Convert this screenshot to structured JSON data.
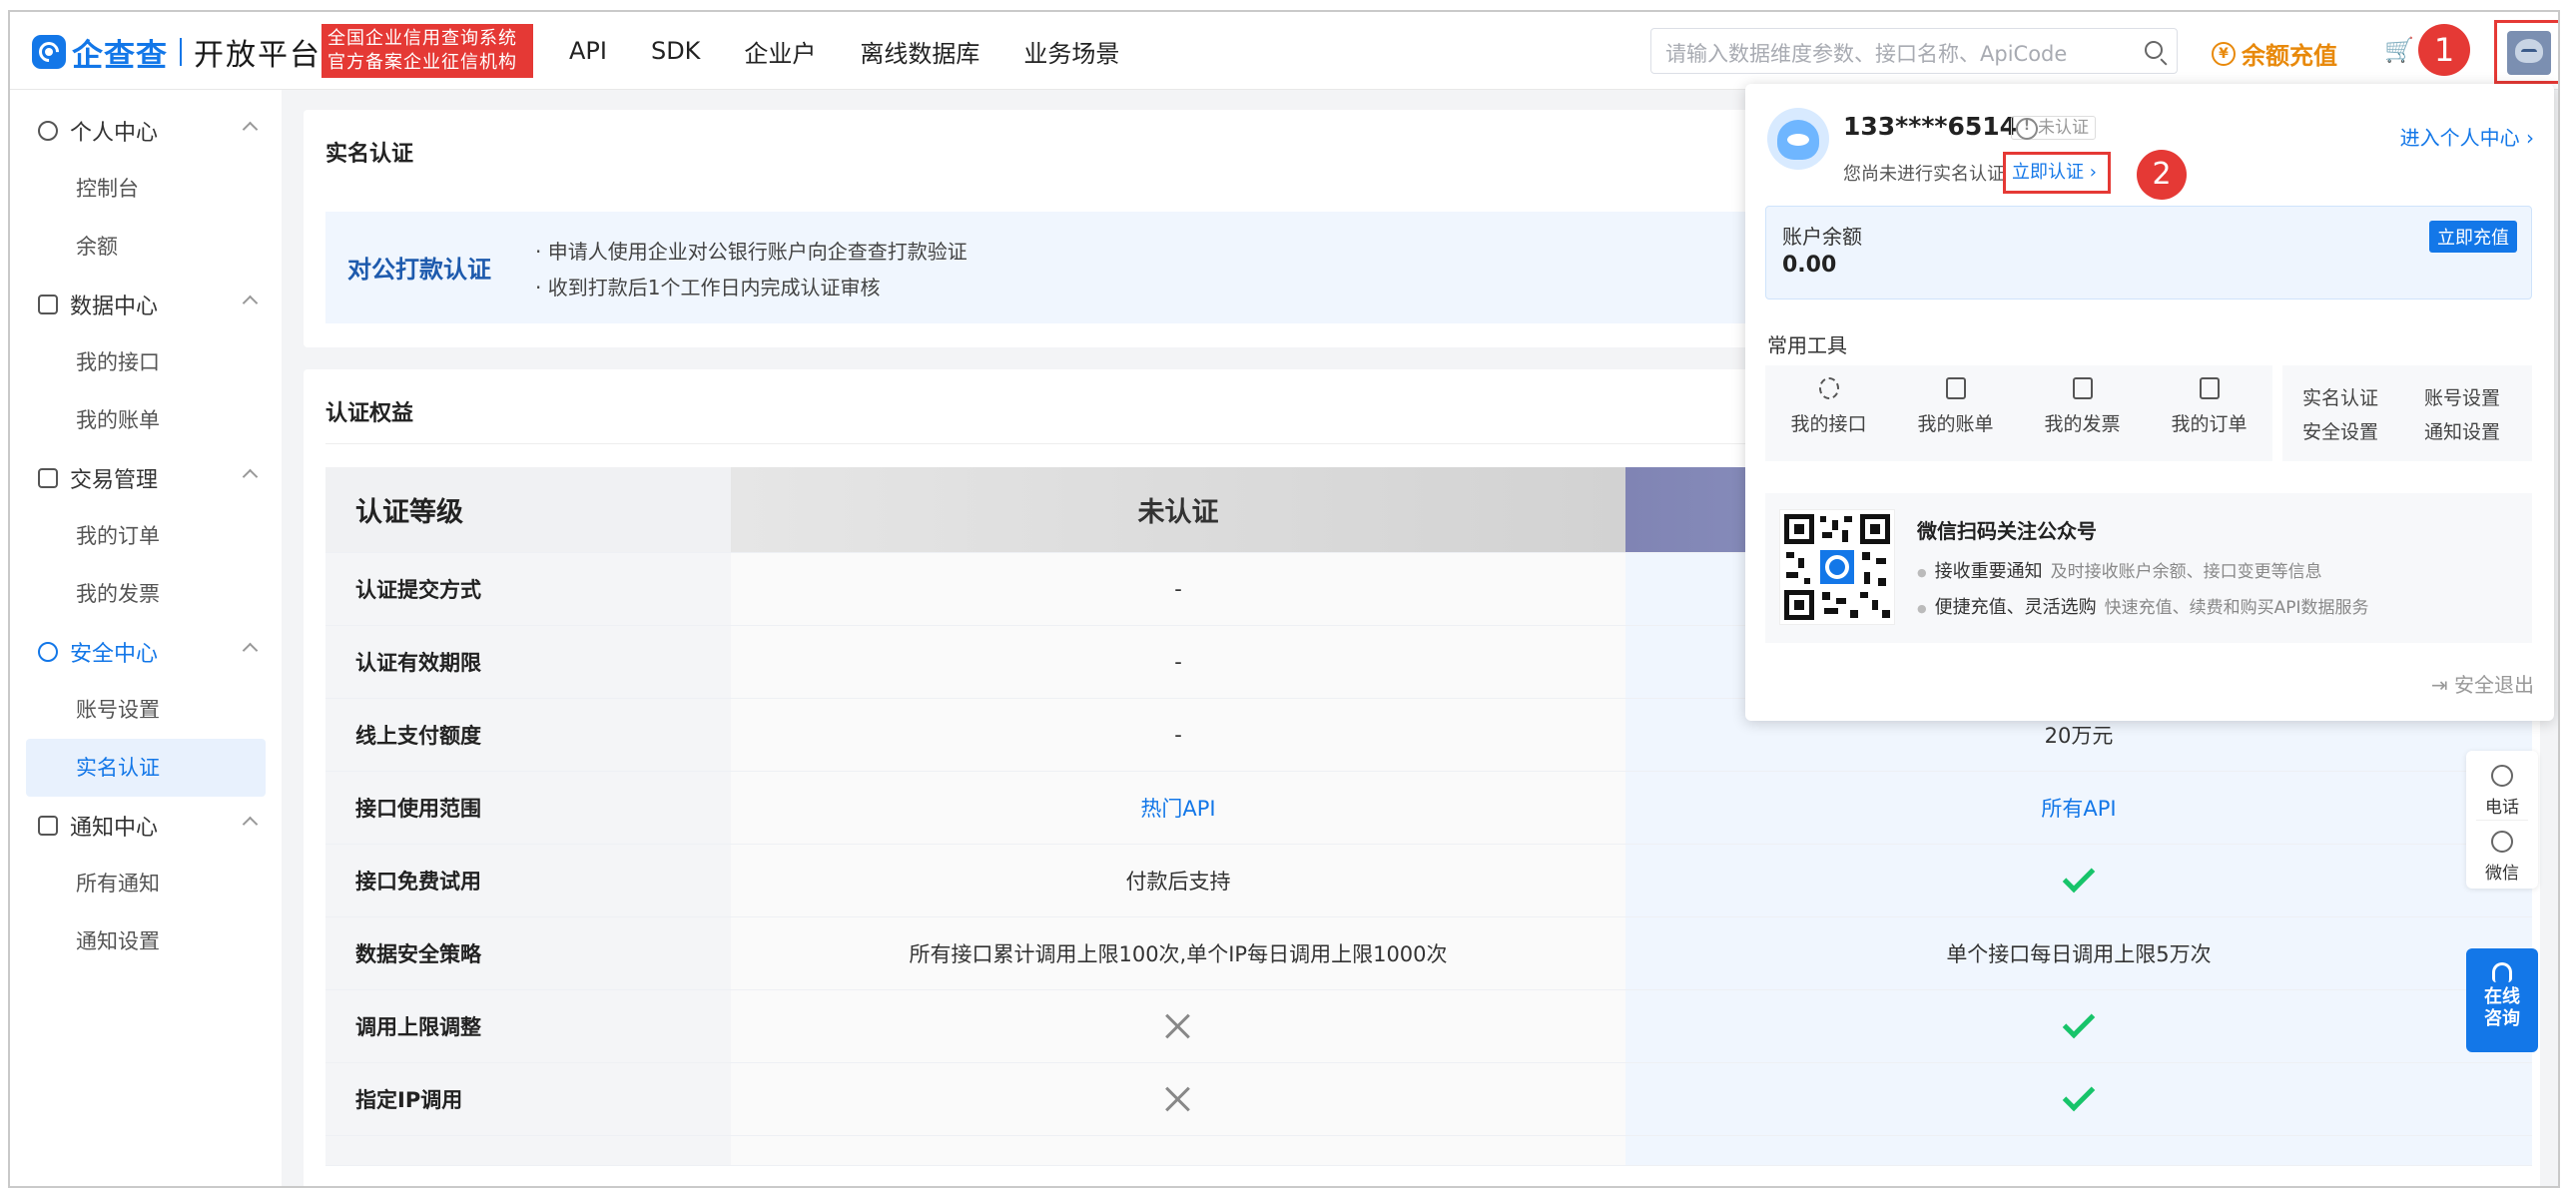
{
  "header": {
    "brand": "企查查",
    "platform": "开放平台",
    "badge_line1": "全国企业信用查询系统",
    "badge_line2": "官方备案企业征信机构",
    "nav": [
      "API",
      "SDK",
      "企业户",
      "离线数据库",
      "业务场景"
    ],
    "search_placeholder": "请输入数据维度参数、接口名称、ApiCode",
    "recharge": "余额充值",
    "callout1": "1",
    "callout2": "2"
  },
  "sidebar": {
    "groups": [
      {
        "label": "个人中心",
        "icon": "user-icon",
        "items": [
          "控制台",
          "余额"
        ]
      },
      {
        "label": "数据中心",
        "icon": "data-icon",
        "items": [
          "我的接口",
          "我的账单"
        ]
      },
      {
        "label": "交易管理",
        "icon": "trade-icon",
        "items": [
          "我的订单",
          "我的发票"
        ]
      },
      {
        "label": "安全中心",
        "icon": "shield-icon",
        "items": [
          "账号设置",
          "实名认证"
        ],
        "active": true
      },
      {
        "label": "通知中心",
        "icon": "bell-icon",
        "items": [
          "所有通知",
          "通知设置"
        ]
      }
    ]
  },
  "main": {
    "section1_title": "实名认证",
    "pay_title": "对公打款认证",
    "pay_line1": "申请人使用企业对公银行账户向企查查打款验证",
    "pay_line2": "收到打款后1个工作日内完成认证审核",
    "section2_title": "认证权益",
    "table": {
      "col0": "认证等级",
      "col1": "未认证",
      "rows": [
        {
          "label": "认证提交方式",
          "v1": "-",
          "v2": ""
        },
        {
          "label": "认证有效期限",
          "v1": "-",
          "v2": ""
        },
        {
          "label": "线上支付额度",
          "v1": "-",
          "v2": "20万元"
        },
        {
          "label": "接口使用范围",
          "v1": "热门API",
          "v2": "所有API"
        },
        {
          "label": "接口免费试用",
          "v1": "付款后支持",
          "v2": "check"
        },
        {
          "label": "数据安全策略",
          "v1": "所有接口累计调用上限100次,单个IP每日调用上限1000次",
          "v2": "单个接口每日调用上限5万次"
        },
        {
          "label": "调用上限调整",
          "v1": "cross",
          "v2": "check"
        },
        {
          "label": "指定IP调用",
          "v1": "cross",
          "v2": "check"
        }
      ]
    }
  },
  "popup": {
    "phone": "133****6514",
    "status": "未认证",
    "note": "您尚未进行实名认证",
    "verify_link": "立即认证 ›",
    "enter": "进入个人中心 ›",
    "balance_label": "账户余额",
    "balance_value": "0.00",
    "balance_btn": "立即充值",
    "tools_title": "常用工具",
    "tools": [
      "我的接口",
      "我的账单",
      "我的发票",
      "我的订单"
    ],
    "links": [
      "实名认证",
      "账号设置",
      "安全设置",
      "通知设置"
    ],
    "qr_title": "微信扫码关注公众号",
    "qr_line1": "接收重要通知",
    "qr_line1_sub": "及时接收账户余额、接口变更等信息",
    "qr_line2": "便捷充值、灵活选购",
    "qr_line2_sub": "快速充值、续费和购买API数据服务",
    "logout": "安全退出"
  },
  "float": {
    "phone": "电话",
    "wechat": "微信",
    "consult_1": "在线",
    "consult_2": "咨询"
  }
}
